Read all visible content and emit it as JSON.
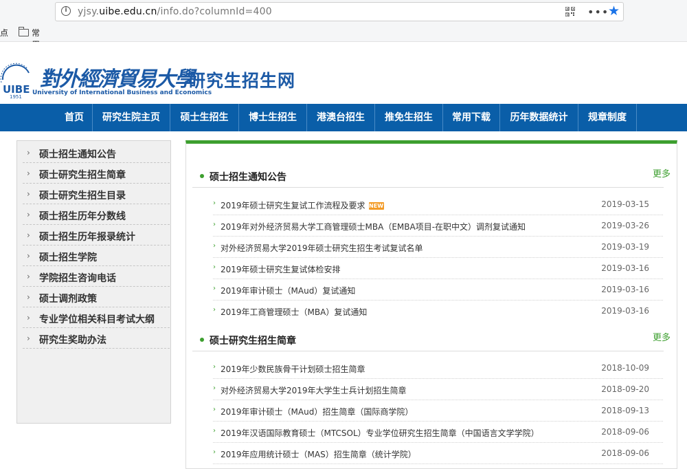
{
  "browser": {
    "url_prefix": "yjsy.",
    "url_domain": "uibe.edu.cn",
    "url_path": "/info.do?columnId=400",
    "bookmark_first": "点",
    "bookmark_folder": "常用网址"
  },
  "header": {
    "logo_cn": "對外經濟貿易大學",
    "logo_en": "University of International Business and Economics",
    "logo_year": "1951",
    "site_title": "研究生招生网"
  },
  "nav": [
    "首页",
    "研究生院主页",
    "硕士生招生",
    "博士生招生",
    "港澳台招生",
    "推免生招生",
    "常用下载",
    "历年数据统计",
    "规章制度"
  ],
  "sidebar": [
    "硕士招生通知公告",
    "硕士研究生招生简章",
    "硕士研究生招生目录",
    "硕士招生历年分数线",
    "硕士招生历年报录统计",
    "硕士招生学院",
    "学院招生咨询电话",
    "硕士调剂政策",
    "专业学位相关科目考试大纲",
    "研究生奖助办法"
  ],
  "sections": [
    {
      "title": "硕士招生通知公告",
      "more": "更多",
      "items": [
        {
          "title": "2019年硕士研究生复试工作流程及要求",
          "date": "2019-03-15",
          "badge": "NEW"
        },
        {
          "title": "2019年对外经济贸易大学工商管理硕士MBA（EMBA项目-在职中文）调剂复试通知",
          "date": "2019-03-26"
        },
        {
          "title": "对外经济贸易大学2019年硕士研究生招生考试复试名单",
          "date": "2019-03-19"
        },
        {
          "title": "2019年硕士研究生复试体检安排",
          "date": "2019-03-16"
        },
        {
          "title": "2019年审计硕士（MAud）复试通知",
          "date": "2019-03-16"
        },
        {
          "title": "2019年工商管理硕士（MBA）复试通知",
          "date": "2019-03-16"
        }
      ]
    },
    {
      "title": "硕士研究生招生简章",
      "more": "更多",
      "items": [
        {
          "title": "2019年少数民族骨干计划硕士招生简章",
          "date": "2018-10-09"
        },
        {
          "title": "对外经济贸易大学2019年大学生士兵计划招生简章",
          "date": "2018-09-20"
        },
        {
          "title": "2019年审计硕士（MAud）招生简章（国际商学院）",
          "date": "2018-09-13"
        },
        {
          "title": "2019年汉语国际教育硕士（MTCSOL）专业学位研究生招生简章（中国语言文学学院）",
          "date": "2018-09-06"
        },
        {
          "title": "2019年应用统计硕士（MAS）招生简章（统计学院）",
          "date": "2018-09-06"
        }
      ]
    }
  ],
  "colors": {
    "nav_blue": "#0a5ea8",
    "accent_green": "#3d9f2f",
    "badge_orange": "#f39b26"
  }
}
